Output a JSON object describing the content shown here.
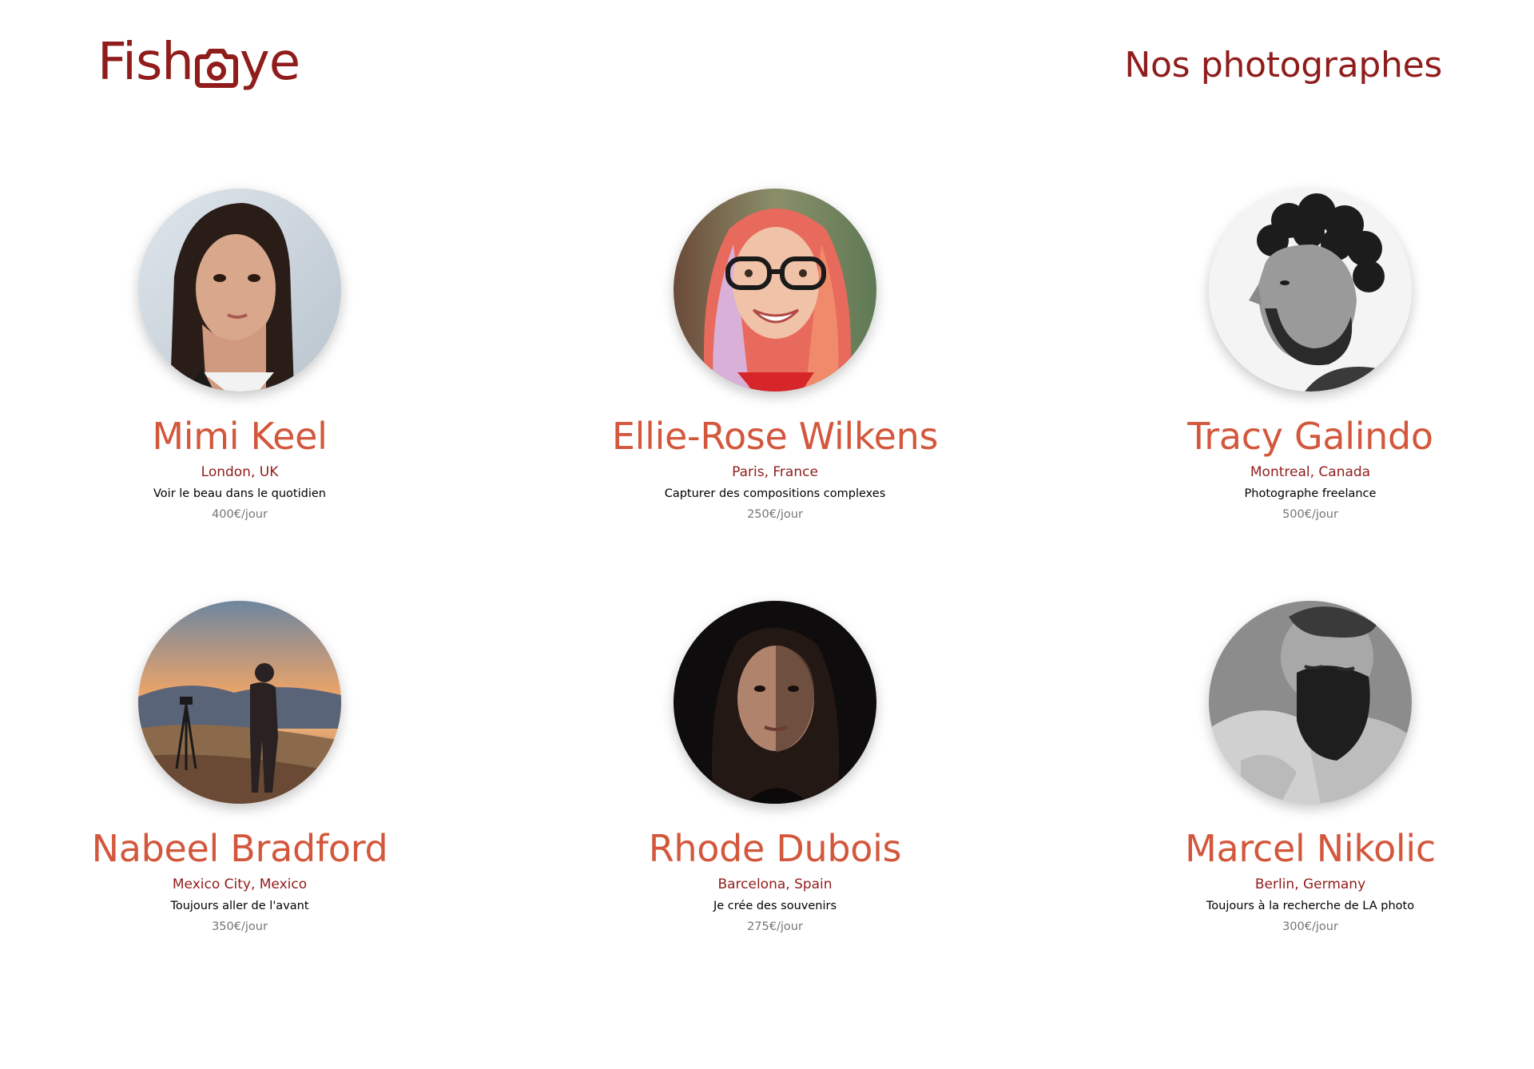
{
  "header": {
    "logo_left": "Fish",
    "logo_right": "ye",
    "logo_icon": "camera-icon",
    "title": "Nos photographes"
  },
  "colors": {
    "brand_dark": "#901C1C",
    "brand_accent": "#D3573C",
    "price_gray": "#757575"
  },
  "photographers": [
    {
      "name": "Mimi Keel",
      "location": "London, UK",
      "tagline": "Voir le beau dans le quotidien",
      "price": "400€/jour"
    },
    {
      "name": "Ellie-Rose Wilkens",
      "location": "Paris, France",
      "tagline": "Capturer des compositions complexes",
      "price": "250€/jour"
    },
    {
      "name": "Tracy Galindo",
      "location": "Montreal, Canada",
      "tagline": "Photographe freelance",
      "price": "500€/jour"
    },
    {
      "name": "Nabeel Bradford",
      "location": "Mexico City, Mexico",
      "tagline": "Toujours aller de l'avant",
      "price": "350€/jour"
    },
    {
      "name": "Rhode Dubois",
      "location": "Barcelona, Spain",
      "tagline": "Je crée des souvenirs",
      "price": "275€/jour"
    },
    {
      "name": "Marcel Nikolic",
      "location": "Berlin, Germany",
      "tagline": "Toujours à la recherche de LA photo",
      "price": "300€/jour"
    }
  ]
}
